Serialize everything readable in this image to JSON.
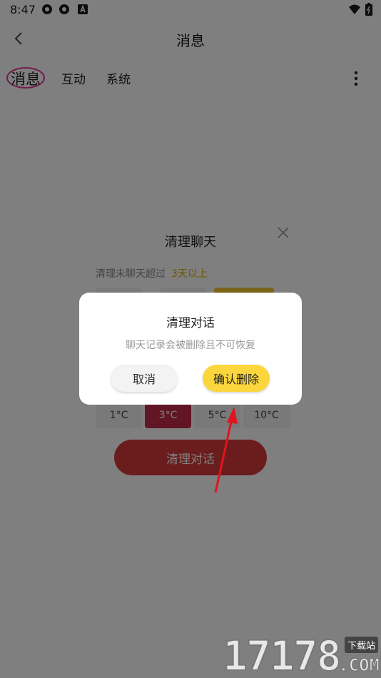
{
  "status_bar": {
    "time": "8:47"
  },
  "header": {
    "title": "消息"
  },
  "tabs": [
    {
      "label": "消息",
      "active": true
    },
    {
      "label": "互动",
      "active": false
    },
    {
      "label": "系统",
      "active": false
    }
  ],
  "clear_sheet": {
    "title": "清理聊天",
    "subtitle_prefix": "清理未聊天超过",
    "subtitle_highlight": "3天以上",
    "temp_options": [
      "1°C",
      "3°C",
      "5°C",
      "10°C"
    ],
    "selected_temp": "3°C",
    "clear_button": "清理对话"
  },
  "dialog": {
    "title": "清理对话",
    "message": "聊天记录会被删除且不可恢复",
    "cancel_label": "取消",
    "confirm_label": "确认删除"
  },
  "watermark": {
    "number": "17178",
    "tag": "下载站",
    "domain": ".COM"
  },
  "colors": {
    "accent_yellow": "#fbd63c",
    "clear_red": "#d63a3a",
    "circle_pink": "#e0369a"
  }
}
